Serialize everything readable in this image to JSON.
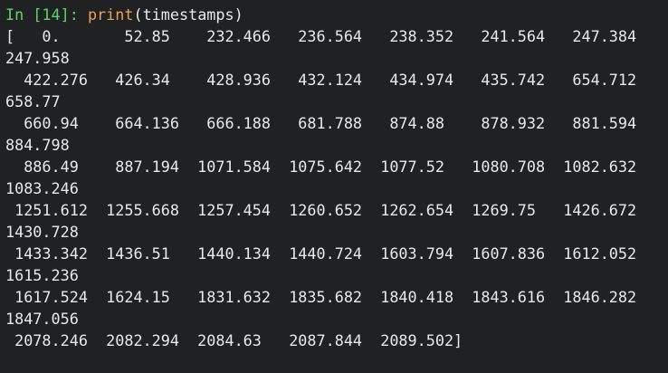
{
  "cell": {
    "prompt": "In [14]: ",
    "function": "print",
    "args": "(timestamps)"
  },
  "output": {
    "lines": [
      "[   0.       52.85    232.466   236.564   238.352   241.564   247.384",
      "247.958",
      "  422.276   426.34    428.936   432.124   434.974   435.742   654.712",
      "658.77",
      "  660.94    664.136   666.188   681.788   874.88    878.932   881.594",
      "884.798",
      "  886.49    887.194  1071.584  1075.642  1077.52   1080.708  1082.632",
      "1083.246",
      " 1251.612  1255.668  1257.454  1260.652  1262.654  1269.75   1426.672",
      "1430.728",
      " 1433.342  1436.51   1440.134  1440.724  1603.794  1607.836  1612.052",
      "1615.236",
      " 1617.524  1624.15   1831.632  1835.682  1840.418  1843.616  1846.282",
      "1847.056",
      " 2078.246  2082.294  2084.63   2087.844  2089.502]"
    ]
  },
  "colors": {
    "background": "#1f2122",
    "prompt": "#5fd46a",
    "function": "#e6a15b",
    "text": "#e9e9e9"
  }
}
